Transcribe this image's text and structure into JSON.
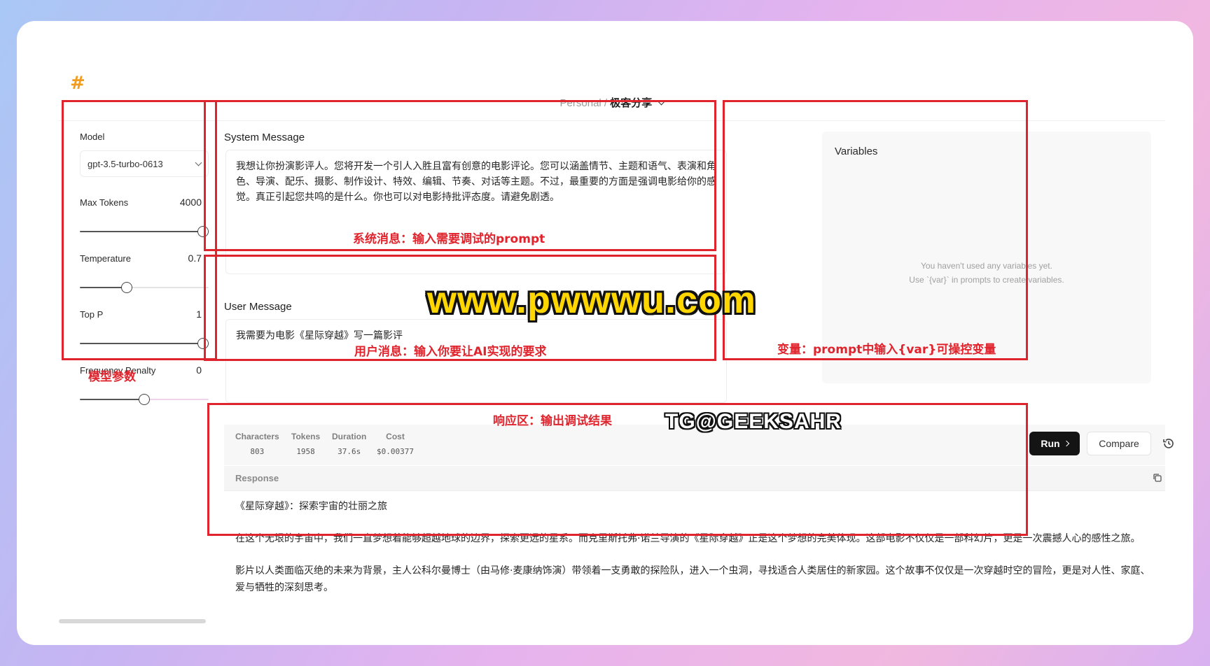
{
  "header": {
    "logo": "#",
    "breadcrumb_workspace": "Personal /",
    "breadcrumb_project": "极客分享"
  },
  "left_panel": {
    "model_label": "Model",
    "model_value": "gpt-3.5-turbo-0613",
    "params": [
      {
        "label": "Max Tokens",
        "value": "4000",
        "level": 1.0
      },
      {
        "label": "Temperature",
        "value": "0.7",
        "level": 0.35
      },
      {
        "label": "Top P",
        "value": "1",
        "level": 1.0
      },
      {
        "label": "Frequency Penalty",
        "value": "0",
        "level": 0.5
      }
    ]
  },
  "system_message": {
    "title": "System Message",
    "text": "我想让你扮演影评人。您将开发一个引人入胜且富有创意的电影评论。您可以涵盖情节、主题和语气、表演和角色、导演、配乐、摄影、制作设计、特效、编辑、节奏、对话等主题。不过，最重要的方面是强调电影给你的感觉。真正引起您共鸣的是什么。你也可以对电影持批评态度。请避免剧透。"
  },
  "user_message": {
    "title": "User Message",
    "text": "我需要为电影《星际穿越》写一篇影评"
  },
  "variables": {
    "title": "Variables",
    "empty_line1": "You haven't used any variables yet.",
    "empty_line2": "Use `{var}` in prompts to create variables."
  },
  "stats": [
    {
      "label": "Characters",
      "value": "803"
    },
    {
      "label": "Tokens",
      "value": "1958"
    },
    {
      "label": "Duration",
      "value": "37.6s"
    },
    {
      "label": "Cost",
      "value": "$0.00377"
    }
  ],
  "toolbar": {
    "run_label": "Run",
    "compare_label": "Compare"
  },
  "response": {
    "title": "Response",
    "paragraphs": [
      "《星际穿越》：探索宇宙的壮丽之旅",
      "在这个无垠的宇宙中，我们一直梦想着能够超越地球的边界，探索更远的星系。而克里斯托弗·诺兰导演的《星际穿越》正是这个梦想的完美体现。这部电影不仅仅是一部科幻片，更是一次震撼人心的感性之旅。",
      "影片以人类面临灭绝的未来为背景，主人公科尔曼博士（由马修·麦康纳饰演）带领着一支勇敢的探险队，进入一个虫洞，寻找适合人类居住的新家园。这个故事不仅仅是一次穿越时空的冒险，更是对人性、家庭、爱与牺牲的深刻思考。"
    ]
  },
  "annotations": {
    "params_note": "模型参数",
    "system_note": "系统消息：输入需要调试的prompt",
    "user_note": "用户消息：输入你要让AI实现的要求",
    "vars_note": "变量：prompt中输入{var}可操控变量",
    "response_note": "响应区：输出调试结果"
  },
  "watermarks": {
    "site": "www.pwwwu.com",
    "tg": "TG@GEEKSAHR"
  },
  "colors": {
    "annotation_red": "#e0242d",
    "run_button": "#141414",
    "watermark_yellow": "#ffd600"
  }
}
